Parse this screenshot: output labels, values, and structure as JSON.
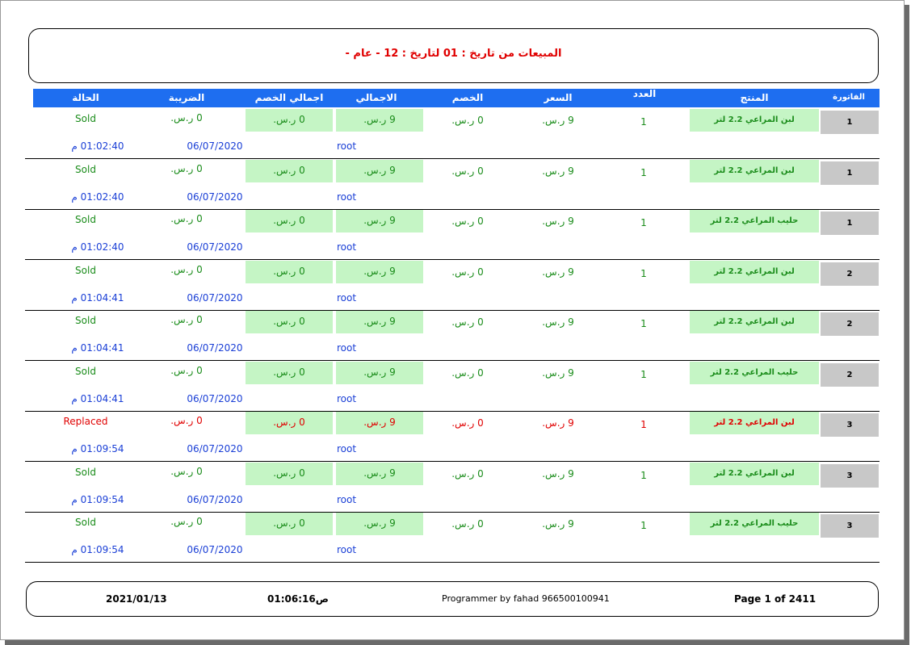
{
  "title": "المبيعات من تاريخ  : 01 لتاريخ : 12 - عام -",
  "headers": {
    "invoice": "الفاتورة",
    "product": "المنتج",
    "qty": "العدد",
    "price": "السعر",
    "discount": "الخصم",
    "total": "الاجمالي",
    "total_discount": "اجمالي الخصم",
    "tax": "الضريبة",
    "status": "الحالة"
  },
  "rows": [
    {
      "invoice": "1",
      "product": "لبن المراعي  2.2 لتر",
      "qty": "1",
      "price": "9 ر.س.",
      "discount": "0 ر.س.",
      "total": "9 ر.س.",
      "total_discount": "0 ر.س.",
      "tax": "0 ر.س.",
      "status": "Sold",
      "user": "root",
      "date": "06/07/2020",
      "time": "01:02:40 م"
    },
    {
      "invoice": "1",
      "product": "لبن المراعي  2.2 لتر",
      "qty": "1",
      "price": "9 ر.س.",
      "discount": "0 ر.س.",
      "total": "9 ر.س.",
      "total_discount": "0 ر.س.",
      "tax": "0 ر.س.",
      "status": "Sold",
      "user": "root",
      "date": "06/07/2020",
      "time": "01:02:40 م"
    },
    {
      "invoice": "1",
      "product": "حليب المراعي 2.2 لتر",
      "qty": "1",
      "price": "9 ر.س.",
      "discount": "0 ر.س.",
      "total": "9 ر.س.",
      "total_discount": "0 ر.س.",
      "tax": "0 ر.س.",
      "status": "Sold",
      "user": "root",
      "date": "06/07/2020",
      "time": "01:02:40 م"
    },
    {
      "invoice": "2",
      "product": "لبن المراعي  2.2 لتر",
      "qty": "1",
      "price": "9 ر.س.",
      "discount": "0 ر.س.",
      "total": "9 ر.س.",
      "total_discount": "0 ر.س.",
      "tax": "0 ر.س.",
      "status": "Sold",
      "user": "root",
      "date": "06/07/2020",
      "time": "01:04:41 م"
    },
    {
      "invoice": "2",
      "product": "لبن المراعي  2.2 لتر",
      "qty": "1",
      "price": "9 ر.س.",
      "discount": "0 ر.س.",
      "total": "9 ر.س.",
      "total_discount": "0 ر.س.",
      "tax": "0 ر.س.",
      "status": "Sold",
      "user": "root",
      "date": "06/07/2020",
      "time": "01:04:41 م"
    },
    {
      "invoice": "2",
      "product": "حليب المراعي 2.2 لتر",
      "qty": "1",
      "price": "9 ر.س.",
      "discount": "0 ر.س.",
      "total": "9 ر.س.",
      "total_discount": "0 ر.س.",
      "tax": "0 ر.س.",
      "status": "Sold",
      "user": "root",
      "date": "06/07/2020",
      "time": "01:04:41 م"
    },
    {
      "invoice": "3",
      "product": "لبن المراعي  2.2 لتر",
      "qty": "1",
      "price": "9 ر.س.",
      "discount": "0 ر.س.",
      "total": "9 ر.س.",
      "total_discount": "0 ر.س.",
      "tax": "0 ر.س.",
      "status": "Replaced",
      "user": "root",
      "date": "06/07/2020",
      "time": "01:09:54 م",
      "highlight": "red"
    },
    {
      "invoice": "3",
      "product": "لبن المراعي  2.2 لتر",
      "qty": "1",
      "price": "9 ر.س.",
      "discount": "0 ر.س.",
      "total": "9 ر.س.",
      "total_discount": "0 ر.س.",
      "tax": "0 ر.س.",
      "status": "Sold",
      "user": "root",
      "date": "06/07/2020",
      "time": "01:09:54 م"
    },
    {
      "invoice": "3",
      "product": "حليب المراعي 2.2 لتر",
      "qty": "1",
      "price": "9 ر.س.",
      "discount": "0 ر.س.",
      "total": "9 ر.س.",
      "total_discount": "0 ر.س.",
      "tax": "0 ر.س.",
      "status": "Sold",
      "user": "root",
      "date": "06/07/2020",
      "time": "01:09:54 م"
    }
  ],
  "footer": {
    "date": "2021/01/13",
    "time": "01:06:16ص",
    "programmer": "Programmer by fahad  966500100941",
    "page": "Page 1 of 2411"
  },
  "colors": {
    "header_bg": "#1e6ef0",
    "sold": "#1a8c1a",
    "replaced": "#e00000",
    "meta": "#1a3fd6",
    "cell_green": "#c5f5c5",
    "invoice_gray": "#c8c8c8"
  }
}
